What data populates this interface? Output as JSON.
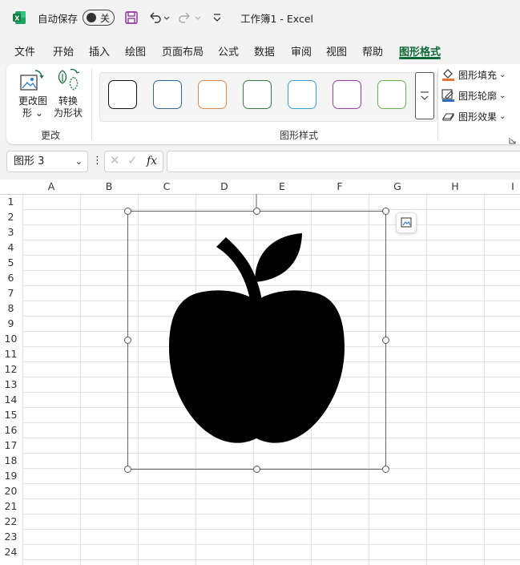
{
  "titlebar": {
    "autosave_label": "自动保存",
    "autosave_state": "关",
    "title": "工作簿1  -  Excel"
  },
  "menu": {
    "tabs": [
      "文件",
      "开始",
      "插入",
      "绘图",
      "页面布局",
      "公式",
      "数据",
      "审阅",
      "视图",
      "帮助",
      "图形格式"
    ],
    "active_tab": "图形格式"
  },
  "ribbon": {
    "change_group": {
      "change_shape_label_line1": "更改图",
      "change_shape_label_line2": "形",
      "convert_label_line1": "转换",
      "convert_label_line2": "为形状",
      "group_label": "更改"
    },
    "styles_group": {
      "group_label": "图形样式",
      "swatch_colors": [
        "#111111",
        "#2e6b9a",
        "#d98a4b",
        "#3d7a3d",
        "#3a9fd0",
        "#9b3fa6",
        "#6bb04e"
      ]
    },
    "shape_commands": {
      "fill_label": "图形填充",
      "outline_label": "图形轮廓",
      "effects_label": "图形效果"
    }
  },
  "formula_bar": {
    "name_box": "图形 3",
    "fx_label": "fx",
    "formula_value": ""
  },
  "grid": {
    "columns": [
      "A",
      "B",
      "C",
      "D",
      "E",
      "F",
      "G",
      "H",
      "I"
    ],
    "rows": [
      "1",
      "2",
      "3",
      "4",
      "5",
      "6",
      "7",
      "8",
      "9",
      "10",
      "11",
      "12",
      "13",
      "14",
      "15",
      "16",
      "17",
      "18",
      "19",
      "20",
      "21",
      "22",
      "23",
      "24"
    ]
  },
  "shape": {
    "name": "apple-icon",
    "fill": "#000000"
  },
  "colors": {
    "accent_green": "#0e6a37",
    "excel_green": "#1d6f42",
    "save_purple": "#8a2f9c"
  }
}
